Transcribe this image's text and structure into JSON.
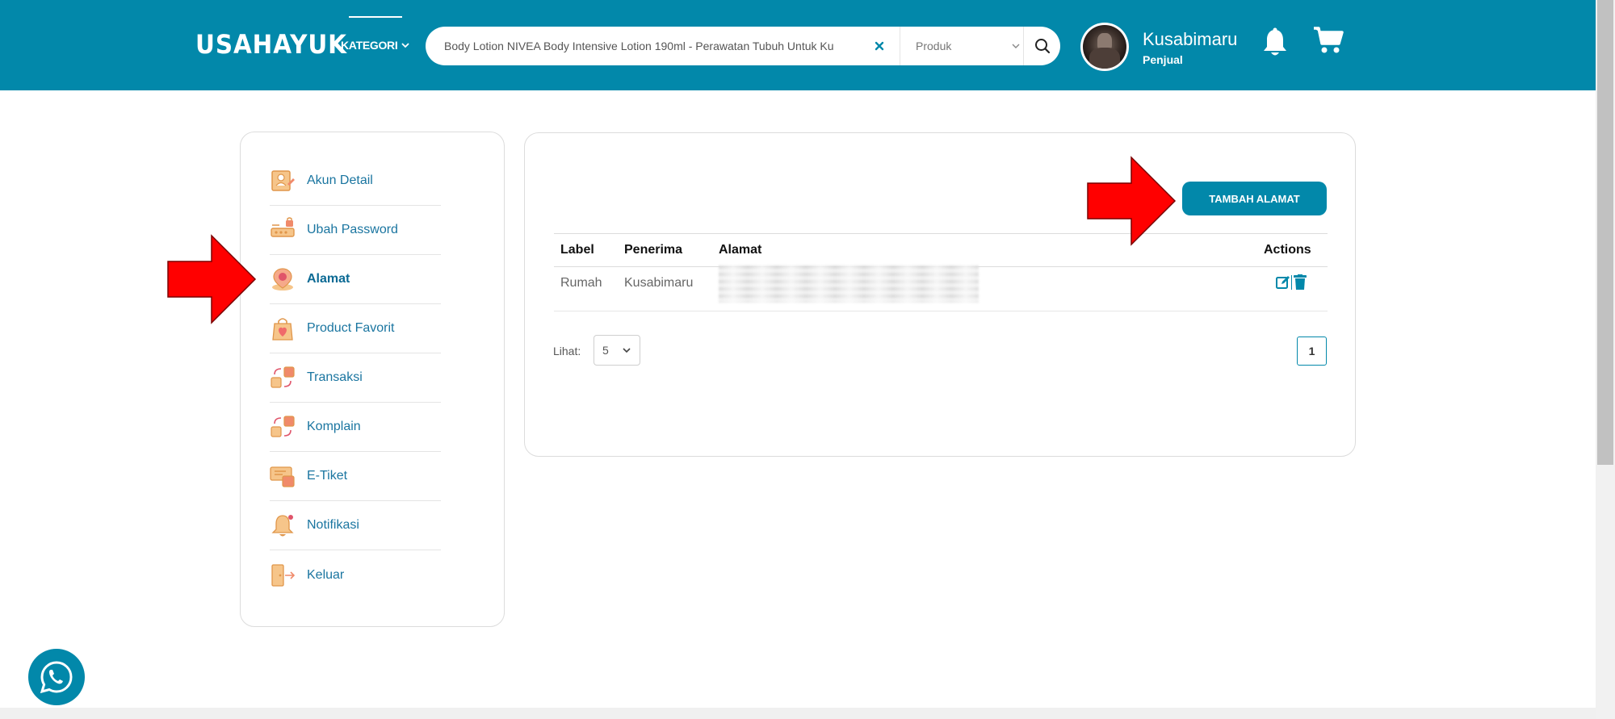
{
  "header": {
    "logo": "USAHAYUK",
    "kategori_label": "KATEGORI",
    "search": {
      "value": "Body Lotion NIVEA Body Intensive Lotion 190ml - Perawatan Tubuh Untuk Ku",
      "select_value": "Produk"
    },
    "user": {
      "name": "Kusabimaru",
      "role": "Penjual"
    }
  },
  "sidebar": {
    "items": [
      {
        "label": "Akun Detail",
        "icon": "account-detail-icon"
      },
      {
        "label": "Ubah Password",
        "icon": "change-password-icon"
      },
      {
        "label": "Alamat",
        "icon": "address-pin-icon"
      },
      {
        "label": "Product Favorit",
        "icon": "favorite-product-icon"
      },
      {
        "label": "Transaksi",
        "icon": "transaction-icon"
      },
      {
        "label": "Komplain",
        "icon": "complaint-icon"
      },
      {
        "label": "E-Tiket",
        "icon": "e-ticket-icon"
      },
      {
        "label": "Notifikasi",
        "icon": "notification-bell-icon"
      },
      {
        "label": "Keluar",
        "icon": "logout-door-icon"
      }
    ],
    "active": "Alamat"
  },
  "main": {
    "add_button_label": "TAMBAH ALAMAT",
    "table": {
      "headers": [
        "Label",
        "Penerima",
        "Alamat",
        "Actions"
      ],
      "rows": [
        {
          "label": "Rumah",
          "penerima": "Kusabimaru",
          "alamat": ""
        }
      ]
    },
    "pagination": {
      "lihat_label": "Lihat:",
      "per_page": "5",
      "current_page": "1"
    }
  },
  "colors": {
    "primary": "#0288aa",
    "annotation_arrow": "#ff0000"
  }
}
